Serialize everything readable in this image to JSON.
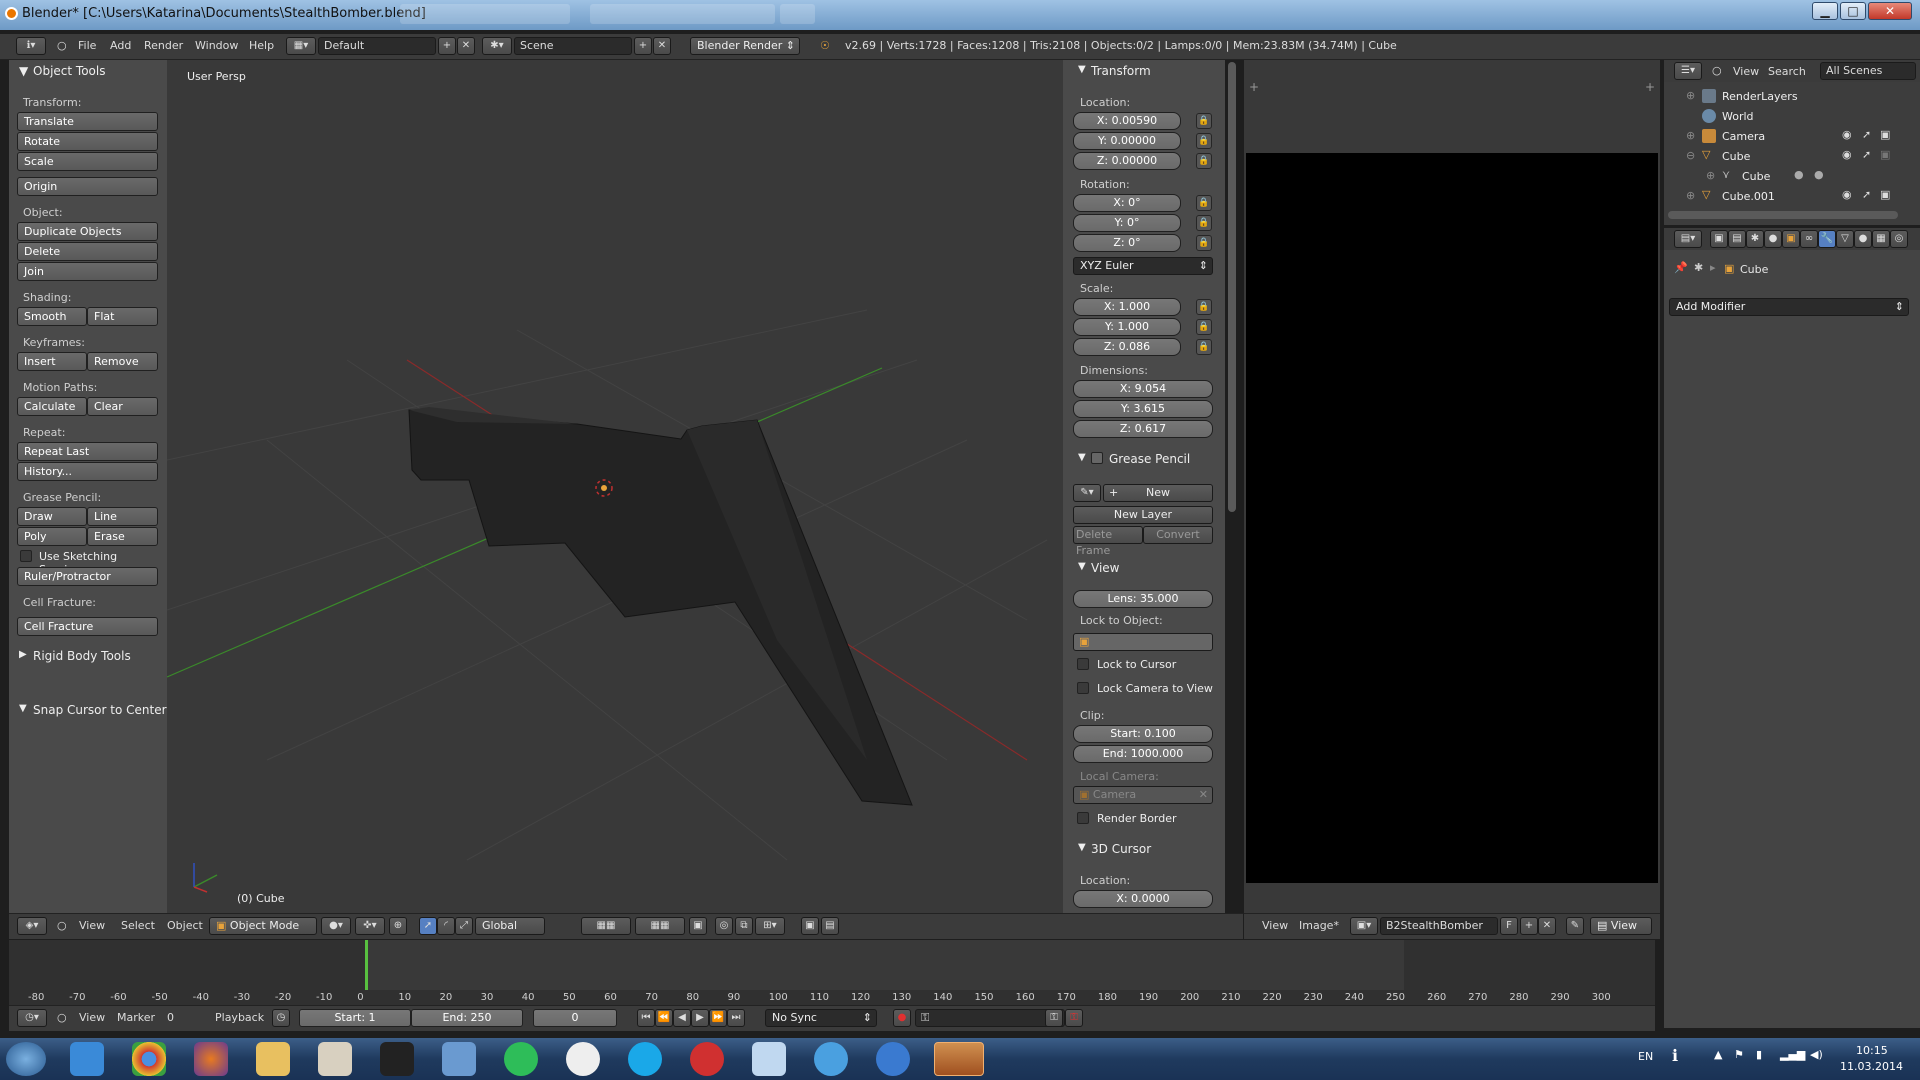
{
  "window": {
    "title": "Blender* [C:\\Users\\Katarina\\Documents\\StealthBomber.blend]",
    "minimize": "▁",
    "maximize": "□",
    "close": "✕"
  },
  "menu": {
    "file": "File",
    "add": "Add",
    "render": "Render",
    "window": "Window",
    "help": "Help"
  },
  "header": {
    "screen_layout": "Default",
    "scene": "Scene",
    "render_engine": "Blender Render",
    "stats": "v2.69 | Verts:1728 | Faces:1208 | Tris:2108 | Objects:0/2 | Lamps:0/0 | Mem:23.83M (34.74M) | Cube"
  },
  "tool_panel": {
    "title": "Object Tools",
    "transform_label": "Transform:",
    "translate": "Translate",
    "rotate": "Rotate",
    "scale": "Scale",
    "origin": "Origin",
    "object_label": "Object:",
    "duplicate": "Duplicate Objects",
    "delete": "Delete",
    "join": "Join",
    "shading_label": "Shading:",
    "smooth": "Smooth",
    "flat": "Flat",
    "keyframes_label": "Keyframes:",
    "insert": "Insert",
    "remove": "Remove",
    "motion_paths_label": "Motion Paths:",
    "calculate": "Calculate",
    "clear": "Clear",
    "repeat_label": "Repeat:",
    "repeat_last": "Repeat Last",
    "history": "History...",
    "grease_label": "Grease Pencil:",
    "draw": "Draw",
    "line": "Line",
    "poly": "Poly",
    "erase": "Erase",
    "use_sketching": "Use Sketching Sessions",
    "ruler": "Ruler/Protractor",
    "cell_fracture_label": "Cell Fracture:",
    "cell_fracture": "Cell Fracture",
    "rigid_body": "Rigid Body Tools",
    "snap_cursor": "Snap Cursor to Center"
  },
  "viewport": {
    "view_name": "User Persp",
    "object_label": "(0) Cube"
  },
  "n_panel": {
    "transform_title": "Transform",
    "location_label": "Location:",
    "loc_x": "X: 0.00590",
    "loc_y": "Y: 0.00000",
    "loc_z": "Z: 0.00000",
    "rotation_label": "Rotation:",
    "rot_x": "X: 0°",
    "rot_y": "Y: 0°",
    "rot_z": "Z: 0°",
    "rotation_mode": "XYZ Euler",
    "scale_label": "Scale:",
    "scale_x": "X: 1.000",
    "scale_y": "Y: 1.000",
    "scale_z": "Z: 0.086",
    "dimensions_label": "Dimensions:",
    "dim_x": "X: 9.054",
    "dim_y": "Y: 3.615",
    "dim_z": "Z: 0.617",
    "grease_title": "Grease Pencil",
    "new": "New",
    "new_layer": "New Layer",
    "delete_frame": "Delete Frame",
    "convert": "Convert",
    "view_title": "View",
    "lens": "Lens: 35.000",
    "lock_to_object": "Lock to Object:",
    "lock_to_cursor": "Lock to Cursor",
    "lock_camera": "Lock Camera to View",
    "clip_label": "Clip:",
    "clip_start": "Start: 0.100",
    "clip_end": "End: 1000.000",
    "local_camera_label": "Local Camera:",
    "camera": "Camera",
    "render_border": "Render Border",
    "cursor_title": "3D Cursor",
    "cursor_location_label": "Location:",
    "cursor_x": "X: 0.0000"
  },
  "outliner": {
    "view": "View",
    "search": "Search",
    "all_scenes": "All Scenes",
    "items": [
      {
        "label": "RenderLayers"
      },
      {
        "label": "World"
      },
      {
        "label": "Camera"
      },
      {
        "label": "Cube"
      },
      {
        "label": "Cube"
      },
      {
        "label": "Cube.001"
      }
    ]
  },
  "properties": {
    "context_object": "Cube",
    "add_modifier": "Add Modifier"
  },
  "view3d_header": {
    "view": "View",
    "select": "Select",
    "object": "Object",
    "mode": "Object Mode",
    "orientation": "Global"
  },
  "image_header": {
    "view": "View",
    "image": "Image*",
    "image_name": "B2StealthBomber",
    "fake_user": "F",
    "view_mode": "View"
  },
  "timeline": {
    "ticks": [
      "-80",
      "-70",
      "-60",
      "-50",
      "-40",
      "-30",
      "-20",
      "-10",
      "0",
      "10",
      "20",
      "30",
      "40",
      "50",
      "60",
      "70",
      "80",
      "90",
      "100",
      "110",
      "120",
      "130",
      "140",
      "150",
      "160",
      "170",
      "180",
      "190",
      "200",
      "210",
      "220",
      "230",
      "240",
      "250",
      "260",
      "270",
      "280",
      "290",
      "300"
    ],
    "current_frame": "0"
  },
  "timeline_header": {
    "view": "View",
    "marker": "Marker",
    "frame": "0",
    "playback": "Playback",
    "start": "Start: 1",
    "end": "End: 250",
    "sync": "No Sync"
  },
  "taskbar": {
    "lang": "EN",
    "time": "10:15",
    "date": "11.03.2014"
  },
  "colors": {
    "accent": "#5680c2",
    "object_orange": "#e8a33b",
    "x_axis": "#8a2a2a",
    "y_axis": "#3a8a2a"
  }
}
